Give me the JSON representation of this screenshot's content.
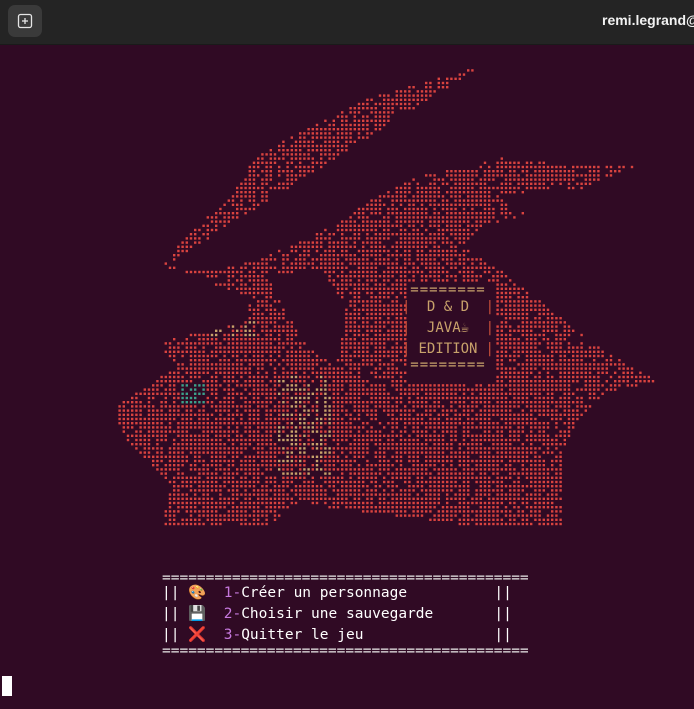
{
  "window": {
    "title": "remi.legrand@",
    "new_tab_icon": "new-tab-icon"
  },
  "ascii_art": {
    "subject": "dragon-head",
    "colors": {
      "body": "#d9433f",
      "eye": "#3ca08a",
      "accent": "#c8a26b"
    }
  },
  "badge": {
    "top_rule": "========",
    "line1": "D & D",
    "line2": "JAVA☕",
    "line3": "EDITION",
    "bottom_rule": "========"
  },
  "menu": {
    "rule": "==========================================",
    "wall": "||",
    "items": [
      {
        "icon": "palette-icon",
        "glyph": "🎨",
        "number": "1-",
        "label": "Créer un personnage"
      },
      {
        "icon": "floppy-disk-icon",
        "glyph": "💾",
        "number": "2-",
        "label": "Choisir une sauvegarde"
      },
      {
        "icon": "cross-mark-icon",
        "glyph": "❌",
        "number": "3-",
        "label": "Quitter le jeu"
      }
    ]
  }
}
